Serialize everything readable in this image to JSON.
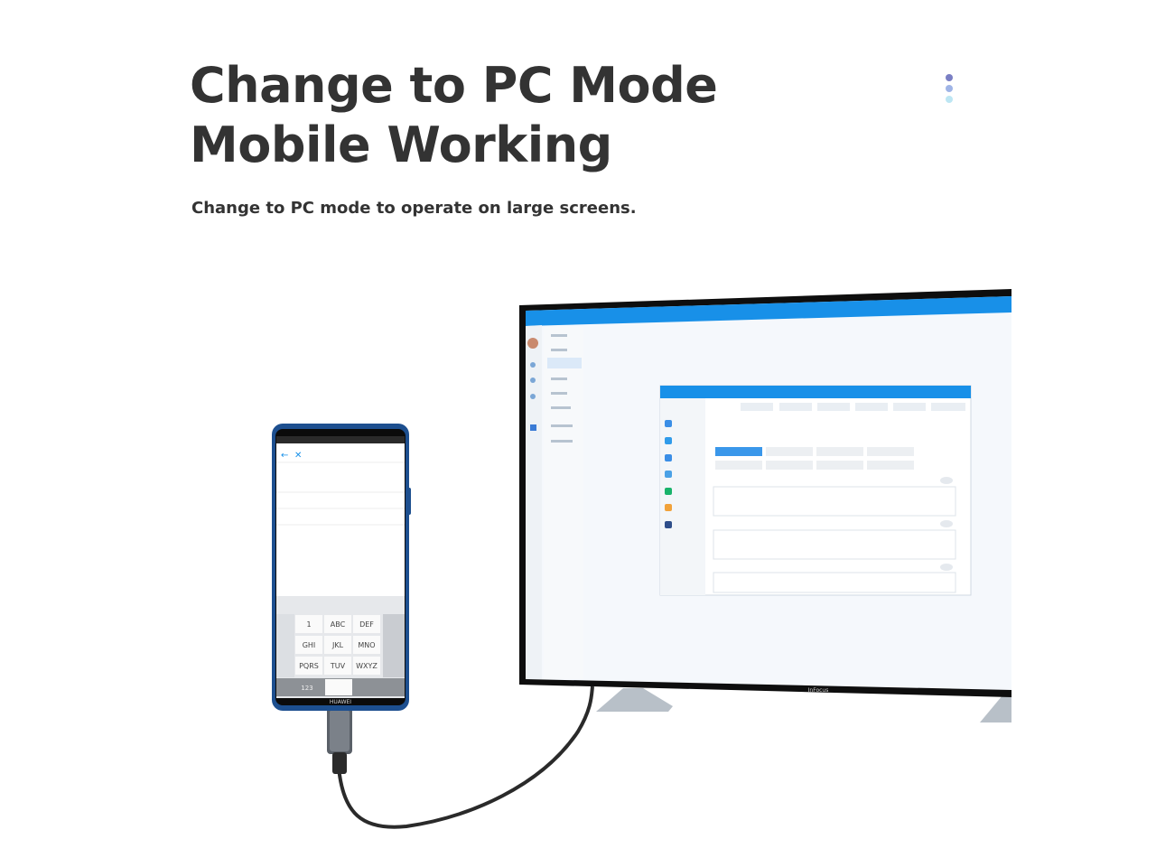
{
  "headline": {
    "line1": "Change to PC Mode",
    "line2": "Mobile Working"
  },
  "subtitle": "Change to PC mode to operate on large screens.",
  "decoration": {
    "dot_colors": [
      "#7a7fc4",
      "#9fb4e6",
      "#bde6f3"
    ]
  },
  "colors": {
    "accent_blue": "#1890e8",
    "text_dark": "#333333",
    "phone_frame": "#1d4f8f"
  },
  "phone": {
    "brand": "HUAWEI",
    "keys_row1": [
      "1",
      "ABC",
      "DEF"
    ],
    "keys_row2": [
      "GHI",
      "JKL",
      "MNO"
    ],
    "keys_row3": [
      "PQRS",
      "TUV",
      "WXYZ"
    ],
    "key_numeric": "123"
  },
  "tv": {
    "brand": "InFocus"
  }
}
